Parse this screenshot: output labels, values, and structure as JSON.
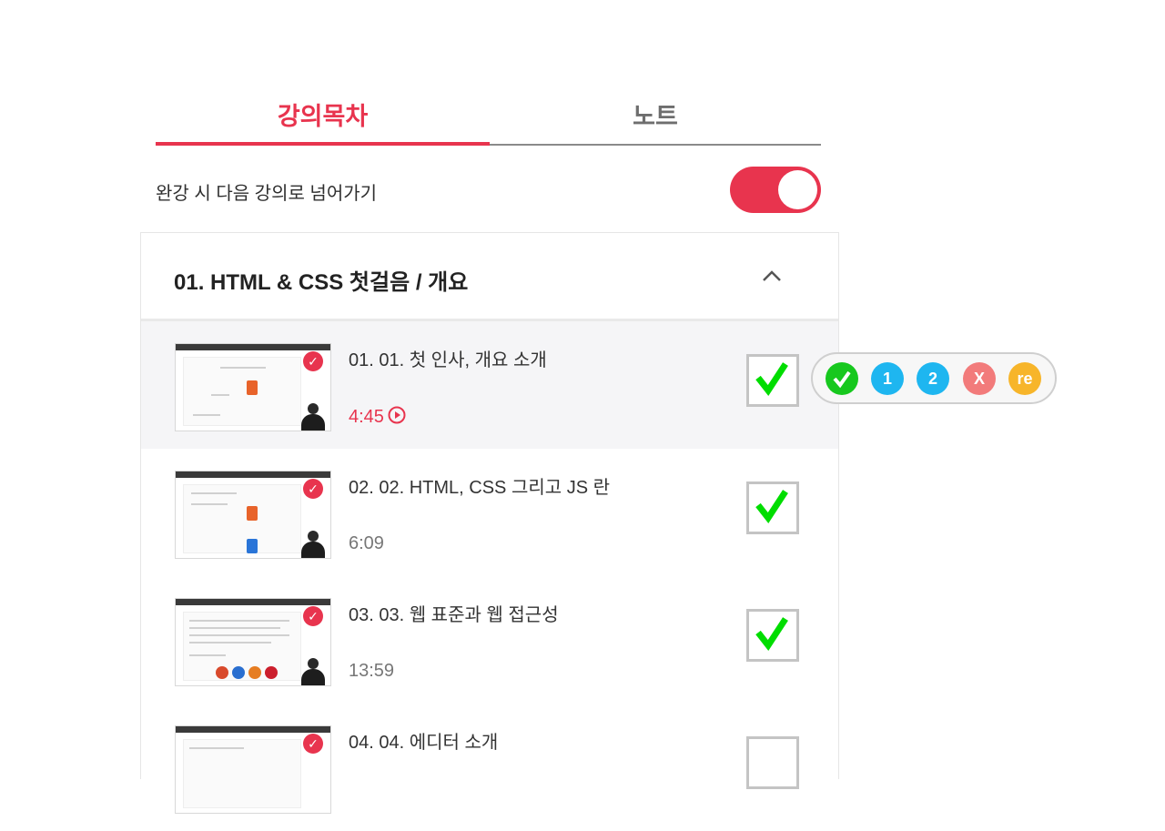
{
  "tabs": [
    {
      "label": "강의목차",
      "active": true
    },
    {
      "label": "노트",
      "active": false
    }
  ],
  "autoplay": {
    "label": "완강 시 다음 강의로 넘어가기",
    "enabled": true
  },
  "section": {
    "title": "01. HTML & CSS 첫걸음 / 개요",
    "expanded": true
  },
  "lectures": [
    {
      "title": "01. 01. 첫 인사, 개요 소개",
      "duration": "4:45",
      "current": true,
      "checked": true
    },
    {
      "title": "02. 02. HTML, CSS 그리고 JS 란",
      "duration": "6:09",
      "current": false,
      "checked": true
    },
    {
      "title": "03. 03. 웹 표준과 웹 접근성",
      "duration": "13:59",
      "current": false,
      "checked": true
    },
    {
      "title": "04. 04. 에디터 소개",
      "duration": "",
      "current": false,
      "checked": false
    }
  ],
  "badges": [
    {
      "icon": "check-circle-icon",
      "label": "",
      "color": "#17c81e"
    },
    {
      "icon": "number-one-icon",
      "label": "1",
      "color": "#1eb6f0"
    },
    {
      "icon": "number-two-icon",
      "label": "2",
      "color": "#1eb6f0"
    },
    {
      "icon": "x-icon",
      "label": "X",
      "color": "#f27b7b"
    },
    {
      "icon": "replay-icon",
      "label": "re",
      "color": "#f7b52a"
    }
  ],
  "colors": {
    "accent": "#e8344e",
    "check_green": "#00dd00"
  }
}
